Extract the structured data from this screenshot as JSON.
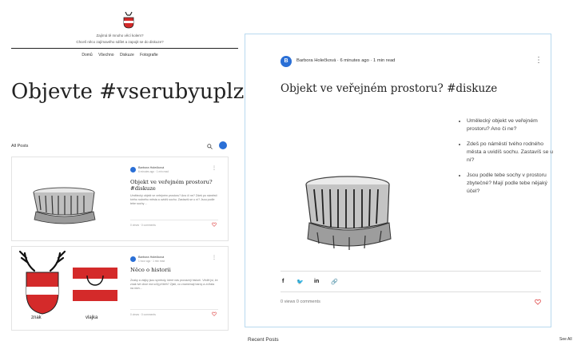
{
  "blog": {
    "tagline_line1": "Zajímá tě mnoho věcí kolem?",
    "tagline_line2": "Chceš něco zajímavého sdílet a zapojit se do diskuze?",
    "nav": [
      "Domů",
      "Všechno",
      "Diskuze",
      "Fotografie"
    ],
    "hero_title": "Objevte #vserubyuplzne",
    "all_posts_label": "All Posts"
  },
  "posts": [
    {
      "author": "Barbora Holečková",
      "meta": "6 minutes ago · 1 min read",
      "title": "Objekt ve veřejném prostoru? #diskuze",
      "excerpt": "Umělecký objekt ve veřejném prostoru? Ano či ne? Zdeš po náměstí tvého rodného města a uvidíš sochu. Zastavíš se u ní? Jsou podle tebe sochy ...",
      "stats": "0 views · 0 comments"
    },
    {
      "author": "Barbora Holečková",
      "meta": "1 hour ago · 1 min read",
      "title": "Něco o historii",
      "excerpt": "Znaky a vlajky jsou symboly, které nás provázejí historií. Věděl jsi, že znak tvé obce má svůj příběh? Zjisti, co znamenají barvy a zvířata na nich...",
      "stats": "0 views · 0 comments",
      "captions": [
        "znak",
        "vlajka"
      ]
    }
  ],
  "detail": {
    "avatar_letter": "B",
    "author_line": "Barbora Holečková · 6 minutes ago · 1 min read",
    "title": "Objekt ve veřejném prostoru? #diskuze",
    "bullets": [
      "Umělecký objekt ve veřejném prostoru? Ano či ne?",
      "Zdeš po náměstí tvého rodného města a uvidíš sochu. Zastavíš se u ní?",
      "Jsou podle tebe sochy v prostoru zbytečné? Mají podle tebe nějaký účel?"
    ],
    "share_icons": [
      "facebook-icon",
      "twitter-icon",
      "linkedin-icon",
      "link-icon"
    ],
    "share_glyphs": [
      "f",
      "🐦",
      "in",
      "🔗"
    ],
    "stats": "0 views   0 comments"
  },
  "recent_posts_label": "Recent Posts",
  "see_all_label": "See All",
  "colors": {
    "accent_blue": "#2a6fd6",
    "heart_red": "#e05050",
    "crest_red": "#d42a2a",
    "card_border": "#b8d9ef"
  }
}
